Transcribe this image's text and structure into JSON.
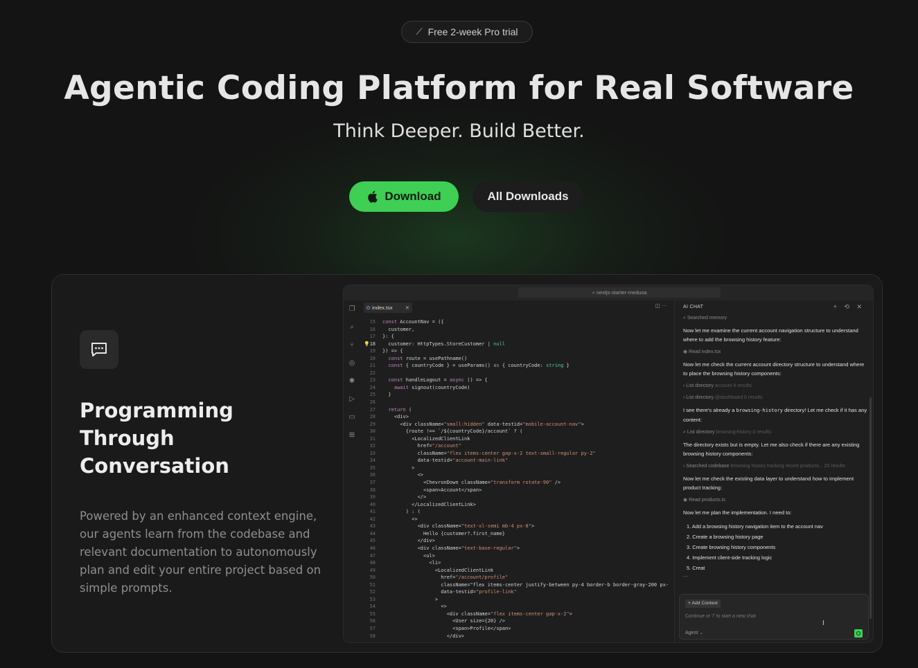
{
  "trial_badge": {
    "label": "Free 2-week Pro trial",
    "icon": "magic-wand-icon"
  },
  "hero": {
    "title": "Agentic Coding Platform for Real Software",
    "subtitle": "Think Deeper. Build Better."
  },
  "buttons": {
    "download": "Download",
    "all_downloads": "All Downloads"
  },
  "colors": {
    "accent": "#3ecf54",
    "background": "#141414",
    "card": "#1a1a1a"
  },
  "feature": {
    "icon": "chat-bubble-icon",
    "title": "Programming Through Conversation",
    "description": "Powered by an enhanced context engine, our agents learn from the codebase and relevant documentation to autonomously plan and edit your entire project based on simple prompts."
  },
  "ide": {
    "search": "nextjs-starter-medusa",
    "tab": "index.tsx",
    "code_lines": [
      {
        "n": "15",
        "t": "const AccountNav = ({"
      },
      {
        "n": "16",
        "t": "  customer,"
      },
      {
        "n": "17",
        "t": "}: {"
      },
      {
        "n": "18",
        "t": "  customer: HttpTypes.StoreCustomer | null"
      },
      {
        "n": "19",
        "t": "}) => {"
      },
      {
        "n": "20",
        "t": "  const route = usePathname()"
      },
      {
        "n": "21",
        "t": "  const { countryCode } = useParams() as { countryCode: string }"
      },
      {
        "n": "22",
        "t": ""
      },
      {
        "n": "23",
        "t": "  const handleLogout = async () => {"
      },
      {
        "n": "24",
        "t": "    await signout(countryCode)"
      },
      {
        "n": "25",
        "t": "  }"
      },
      {
        "n": "26",
        "t": ""
      },
      {
        "n": "27",
        "t": "  return ("
      },
      {
        "n": "28",
        "t": "    <div>"
      },
      {
        "n": "29",
        "t": "      <div className=\"small:hidden\" data-testid=\"mobile-account-nav\">"
      },
      {
        "n": "30",
        "t": "        {route !== `/${countryCode}/account` ? ("
      },
      {
        "n": "31",
        "t": "          <LocalizedClientLink"
      },
      {
        "n": "32",
        "t": "            href=\"/account\""
      },
      {
        "n": "33",
        "t": "            className=\"flex items-center gap-x-2 text-small-regular py-2\""
      },
      {
        "n": "34",
        "t": "            data-testid=\"account-main-link\""
      },
      {
        "n": "35",
        "t": "          >"
      },
      {
        "n": "36",
        "t": "            <>"
      },
      {
        "n": "37",
        "t": "              <ChevronDown className=\"transform rotate-90\" />"
      },
      {
        "n": "38",
        "t": "              <span>Account</span>"
      },
      {
        "n": "39",
        "t": "            </>"
      },
      {
        "n": "40",
        "t": "          </LocalizedClientLink>"
      },
      {
        "n": "41",
        "t": "        ) : ("
      },
      {
        "n": "42",
        "t": "          <>"
      },
      {
        "n": "43",
        "t": "            <div className=\"text-xl-semi mb-4 px-8\">"
      },
      {
        "n": "44",
        "t": "              Hello {customer?.first_name}"
      },
      {
        "n": "45",
        "t": "            </div>"
      },
      {
        "n": "46",
        "t": "            <div className=\"text-base-regular\">"
      },
      {
        "n": "47",
        "t": "              <ul>"
      },
      {
        "n": "48",
        "t": "                <li>"
      },
      {
        "n": "49",
        "t": "                  <LocalizedClientLink"
      },
      {
        "n": "50",
        "t": "                    href=\"/account/profile\""
      },
      {
        "n": "51",
        "t": "                    className=\"flex items-center justify-between py-4 border-b border-gray-200 px-"
      },
      {
        "n": "52",
        "t": "                    data-testid=\"profile-link\""
      },
      {
        "n": "53",
        "t": "                  >"
      },
      {
        "n": "54",
        "t": "                    <>"
      },
      {
        "n": "55",
        "t": "                      <div className=\"flex items-center gap-x-2\">"
      },
      {
        "n": "56",
        "t": "                        <User size={20} />"
      },
      {
        "n": "57",
        "t": "                        <span>Profile</span>"
      },
      {
        "n": "58",
        "t": "                      </div>"
      }
    ],
    "chat": {
      "title": "AI CHAT",
      "tool_memory": "Searched memory",
      "msg1": "Now let me examine the current account navigation structure to understand where to add the browsing history feature:",
      "tool_read1": "Read index.tsx",
      "msg2": "Now let me check the current account directory structure to understand where to place the browsing history components:",
      "tool_list1": "List directory",
      "tool_list1_arg": "account  4 results",
      "tool_list2": "List directory",
      "tool_list2_arg": "@dashboard  6 results",
      "msg3_a": "I see there's already a ",
      "msg3_code": "browsing-history",
      "msg3_b": " directory! Let me check if it has any content:",
      "tool_list3": "List directory",
      "tool_list3_arg": "browsing-history  0 results",
      "msg4": "The directory exists but is empty. Let me also check if there are any existing browsing history components:",
      "tool_search": "Searched codebase",
      "tool_search_arg": "browsing history tracking recent products...  20 results",
      "msg5": "Now let me check the existing data layer to understand how to implement product tracking:",
      "tool_read2": "Read products.ts",
      "msg6": "Now let me plan the implementation. I need to:",
      "steps": [
        "1. Add a browsing history navigation item to the account nav",
        "2. Create a browsing history page",
        "3. Create browsing history components",
        "4. Implement client-side tracking logic",
        "5. Creat"
      ],
      "ellipsis": "...",
      "add_context": "+ Add Context",
      "input_placeholder": "Continue or '/' to start a new chat",
      "mode": "Agent ⌄"
    }
  }
}
